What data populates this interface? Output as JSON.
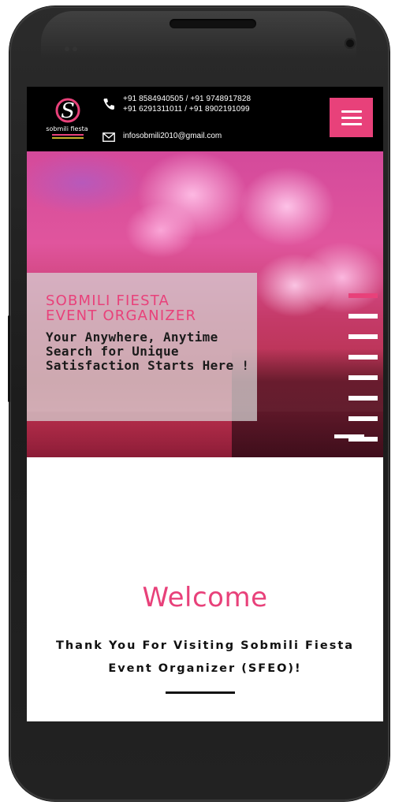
{
  "header": {
    "logo_text": "sobmili fiesta",
    "phone_icon": "phone-icon",
    "phone_line_1": "+91 8584940505 / +91 9748917828",
    "phone_line_2": "+91 6291311011 / +91 8902191099",
    "email_icon": "mail-icon",
    "email": "infosobmili2010@gmail.com",
    "menu_icon": "hamburger-menu-icon",
    "accent_color": "#e8417a"
  },
  "hero": {
    "title_line_1": "SOBMILI FIESTA",
    "title_line_2": "EVENT ORGANIZER",
    "subtitle": "Your Anywhere, Anytime Search for Unique Satisfaction Starts Here !",
    "slide_count": 9,
    "active_slide": 1
  },
  "welcome": {
    "heading": "Welcome",
    "text_line_1": "Thank You For Visiting Sobmili Fiesta",
    "text_line_2": "Event Organizer (SFEO)!"
  }
}
